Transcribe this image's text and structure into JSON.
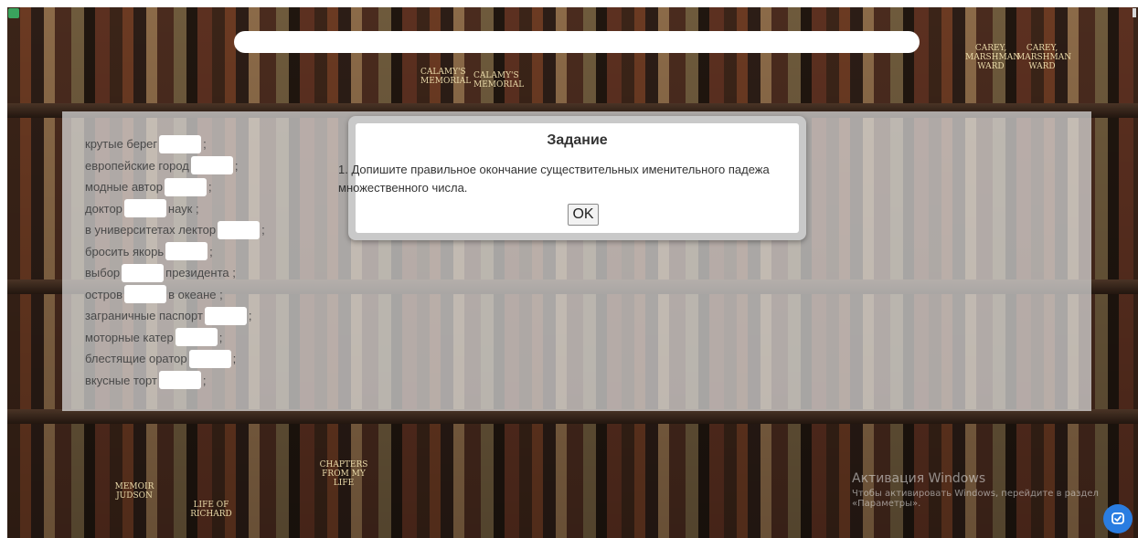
{
  "background": {
    "spine_labels": [
      "CALAMY'S MEMORIAL",
      "CALAMY'S MEMORIAL",
      "CAREY, MARSHMAN WARD",
      "CAREY, MARSHMAN WARD",
      "MEMOIR JUDSON",
      "CHAPTERS FROM MY LIFE",
      "LIFE OF RICHARD"
    ]
  },
  "exercise": {
    "lines": [
      {
        "before": "крутые берег",
        "after": ";"
      },
      {
        "before": "европейские город",
        "after": ";"
      },
      {
        "before": "модные автор",
        "after": ";"
      },
      {
        "before": "доктор",
        "after": "наук ;"
      },
      {
        "before": "в университетах лектор",
        "after": ";"
      },
      {
        "before": "бросить якорь",
        "after": ";"
      },
      {
        "before": "выбор",
        "after": "президента ;"
      },
      {
        "before": "остров",
        "after": "в океане ;"
      },
      {
        "before": "заграничные паспорт",
        "after": ";"
      },
      {
        "before": "моторные катер",
        "after": ";"
      },
      {
        "before": "блестящие оратор",
        "after": ";"
      },
      {
        "before": "вкусные торт",
        "after": ";"
      }
    ]
  },
  "modal": {
    "title": "Задание",
    "text": "1. Допишите правильное окончание существительных именительного падежа множественного числа.",
    "ok_label": "OK"
  },
  "watermark": {
    "title": "Активация Windows",
    "text": "Чтобы активировать Windows, перейдите в раздел «Параметры»."
  },
  "colors": {
    "panel": "#dedede",
    "help_button": "#2a7de1"
  },
  "icons": {
    "help": "chat-check-icon",
    "app": "app-icon"
  }
}
